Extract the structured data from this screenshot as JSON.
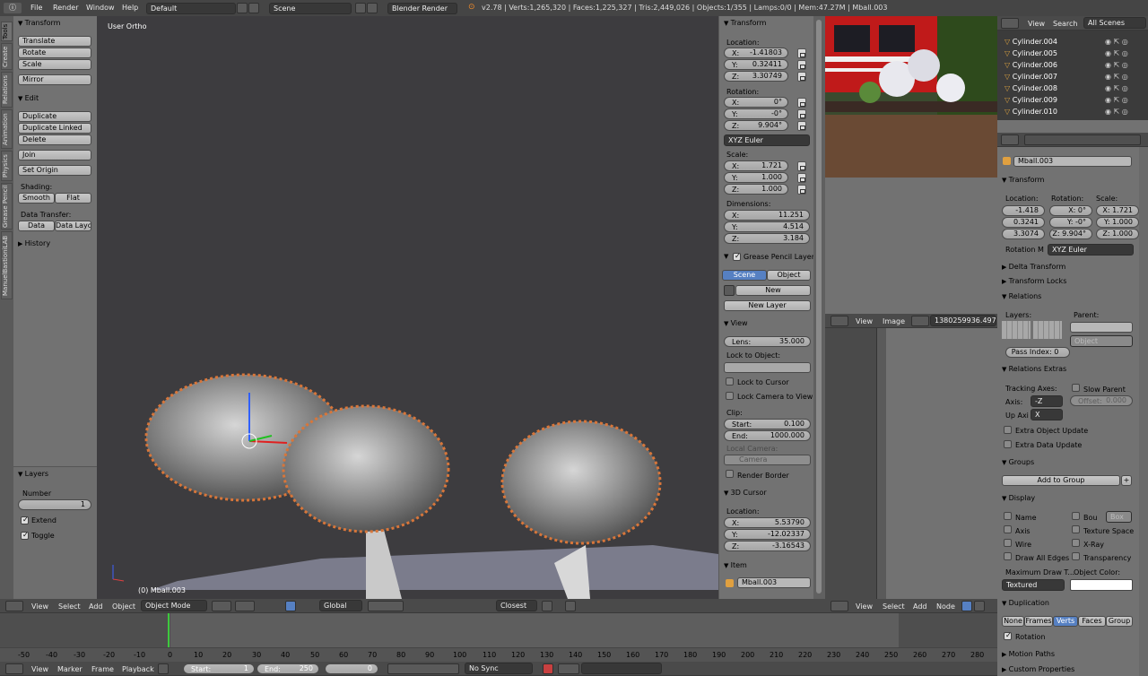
{
  "topbar": {
    "menus": [
      "File",
      "Render",
      "Window",
      "Help"
    ],
    "layout": "Default",
    "scene": "Scene",
    "engine": "Blender Render",
    "stats": "v2.78 | Verts:1,265,320 | Faces:1,225,327 | Tris:2,449,026 | Objects:1/355 | Lamps:0/0 | Mem:47.27M | Mball.003"
  },
  "tool_tabs": [
    "Tools",
    "Create",
    "Relations",
    "Animation",
    "Physics",
    "Grease Pencil",
    "ManuelBastioniLAB"
  ],
  "toolshelf": {
    "transform": "Transform",
    "translate": "Translate",
    "rotate": "Rotate",
    "scale": "Scale",
    "mirror": "Mirror",
    "edit": "Edit",
    "duplicate": "Duplicate",
    "duplicate_linked": "Duplicate Linked",
    "delete": "Delete",
    "join": "Join",
    "set_origin": "Set Origin",
    "shading": "Shading:",
    "smooth": "Smooth",
    "flat": "Flat",
    "data_transfer": "Data Transfer:",
    "data": "Data",
    "data_layo": "Data Layo",
    "history": "History",
    "layers": "Layers",
    "number": "Number",
    "number_value": "1",
    "extend": "Extend",
    "toggle": "Toggle"
  },
  "viewport": {
    "label": "User Ortho",
    "object_label": "(0) Mball.003"
  },
  "viewport_header": {
    "view": "View",
    "select": "Select",
    "add": "Add",
    "object": "Object",
    "mode": "Object Mode",
    "orientation": "Global",
    "snap": "Closest"
  },
  "npanel": {
    "transform": "Transform",
    "location": "Location:",
    "loc": {
      "x": "-1.41803",
      "y": "0.32411",
      "z": "3.30749"
    },
    "rotation": "Rotation:",
    "rot": {
      "x": "0°",
      "y": "-0°",
      "z": "9.904°"
    },
    "rot_mode": "XYZ Euler",
    "scale": "Scale:",
    "scl": {
      "x": "1.721",
      "y": "1.000",
      "z": "1.000"
    },
    "dimensions": "Dimensions:",
    "dim": {
      "x": "11.251",
      "y": "4.514",
      "z": "3.184"
    },
    "x": "X:",
    "y": "Y:",
    "z": "Z:",
    "gp_layers": "Grease Pencil Layers",
    "scene_tab": "Scene",
    "object_tab": "Object",
    "new": "New",
    "new_layer": "New Layer",
    "view": "View",
    "lens_label": "Lens:",
    "lens": "35.000",
    "lock_to_object": "Lock to Object:",
    "lock_to_cursor": "Lock to Cursor",
    "lock_camera": "Lock Camera to View",
    "clip": "Clip:",
    "start_label": "Start:",
    "clip_start": "0.100",
    "end_label": "End:",
    "clip_end": "1000.000",
    "local_camera": "Local Camera:",
    "camera": "Camera",
    "render_border": "Render Border",
    "cursor": "3D Cursor",
    "cursor_location": "Location:",
    "cur": {
      "x": "5.53790",
      "y": "-12.02337",
      "z": "-3.16543"
    },
    "item": "Item",
    "item_name": "Mball.003"
  },
  "image_editor": {
    "view": "View",
    "image": "Image",
    "filename": "1380259936.497..."
  },
  "node_header": {
    "view": "View",
    "select": "Select",
    "add": "Add",
    "node": "Node"
  },
  "outliner": {
    "view": "View",
    "search": "Search",
    "filter": "All Scenes",
    "items": [
      "Cylinder.004",
      "Cylinder.005",
      "Cylinder.006",
      "Cylinder.007",
      "Cylinder.008",
      "Cylinder.009",
      "Cylinder.010"
    ]
  },
  "properties": {
    "name": "Mball.003",
    "transform": "Transform",
    "location": "Location:",
    "rotation": "Rotation:",
    "scale": "Scale:",
    "loc": [
      "-1.418",
      "0.3241",
      "3.3074"
    ],
    "rot": [
      "X: 0°",
      "Y: -0°",
      "Z: 9.904°"
    ],
    "scl": [
      "X: 1.721",
      "Y: 1.000",
      "Z: 1.000"
    ],
    "rotation_mode_label": "Rotation M",
    "rotation_mode": "XYZ Euler",
    "delta_transform": "Delta Transform",
    "transform_locks": "Transform Locks",
    "relations": "Relations",
    "layers": "Layers:",
    "parent": "Parent:",
    "parent_type": "Object",
    "pass_index": "Pass Index:",
    "pass_index_value": "0",
    "relations_extras": "Relations Extras",
    "tracking_axes": "Tracking Axes:",
    "slow_parent": "Slow Parent",
    "axis": "Axis:",
    "axis_value": "-Z",
    "offset": "Offset:",
    "offset_value": "0.000",
    "up_axis": "Up Axi",
    "up_axis_value": "X",
    "extra_object_update": "Extra Object Update",
    "extra_data_update": "Extra Data Update",
    "groups": "Groups",
    "add_to_group": "Add to Group",
    "display": "Display",
    "d_name": "Name",
    "d_bounds": "Bou",
    "d_box": "Box",
    "d_axis": "Axis",
    "d_texture_space": "Texture Space",
    "d_wire": "Wire",
    "d_xray": "X-Ray",
    "d_draw_all_edges": "Draw All Edges",
    "d_transparency": "Transparency",
    "max_draw": "Maximum Draw T...",
    "object_color": "Object Color:",
    "max_draw_value": "Textured",
    "duplication": "Duplication",
    "dup_none": "None",
    "dup_frames": "Frames",
    "dup_verts": "Verts",
    "dup_faces": "Faces",
    "dup_group": "Group",
    "rotation_cb": "Rotation",
    "motion_paths": "Motion Paths",
    "custom_properties": "Custom Properties"
  },
  "timeline": {
    "ticks": [
      "-50",
      "-40",
      "-30",
      "-20",
      "-10",
      "0",
      "10",
      "20",
      "30",
      "40",
      "50",
      "60",
      "70",
      "80",
      "90",
      "100",
      "110",
      "120",
      "130",
      "140",
      "150",
      "160",
      "170",
      "180",
      "190",
      "200",
      "210",
      "220",
      "230",
      "240",
      "250",
      "260",
      "270",
      "280"
    ],
    "view": "View",
    "marker": "Marker",
    "frame": "Frame",
    "playback": "Playback",
    "start_label": "Start:",
    "start": "1",
    "end_label": "End:",
    "end": "250",
    "current": "0",
    "sync": "No Sync"
  },
  "colors": {
    "accent": "#5680c2",
    "viewport_bg": "#3d3c3f",
    "panel": "#727272",
    "header": "#4a4a4a",
    "selection_outline": "#e08a3c"
  }
}
